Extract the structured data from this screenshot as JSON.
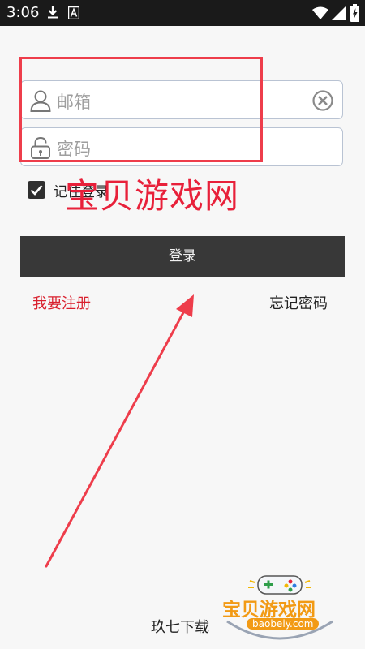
{
  "status_bar": {
    "time": "3:06",
    "icons": [
      "download-icon",
      "font-a-icon",
      "wifi-icon",
      "signal-icon",
      "battery-charging-icon"
    ]
  },
  "login": {
    "email_placeholder": "邮箱",
    "password_placeholder": "密码",
    "remember_label": "记住登录",
    "remember_checked": true,
    "login_button": "登录",
    "register_link": "我要注册",
    "forgot_link": "忘记密码"
  },
  "footer": {
    "text": "玖七下载"
  },
  "watermark": {
    "text": "宝贝游戏网",
    "logo_title": "宝贝游戏网",
    "logo_url": "baobeiy.com"
  },
  "colors": {
    "annotation_red": "#ee3d4b",
    "watermark_red": "#e8203a",
    "register_red": "#d9202e",
    "button_dark": "#383838",
    "input_border": "#b9c3d3",
    "logo_orange": "#f29a14"
  }
}
